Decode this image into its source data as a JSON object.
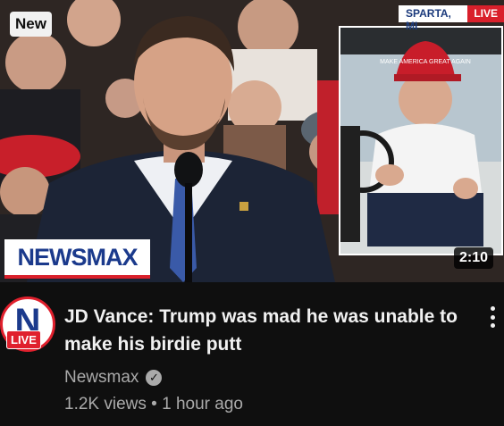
{
  "video": {
    "badge": "New",
    "duration": "2:10",
    "title": "JD Vance: Trump was mad he was unable to make his birdie putt"
  },
  "overlay": {
    "logo_text": "NEWSMAX",
    "location": "SPARTA, MI",
    "live_tag": "LIVE",
    "cap_text": "MAKE AMERICA GREAT AGAIN"
  },
  "channel": {
    "name": "Newsmax",
    "avatar_letter": "N",
    "avatar_live": "LIVE"
  },
  "meta": {
    "views": "1.2K views",
    "separator": "•",
    "age": "1 hour ago"
  },
  "colors": {
    "background": "#0f0f0f",
    "brand_red": "#d9202b",
    "brand_blue": "#1b3a8c"
  }
}
